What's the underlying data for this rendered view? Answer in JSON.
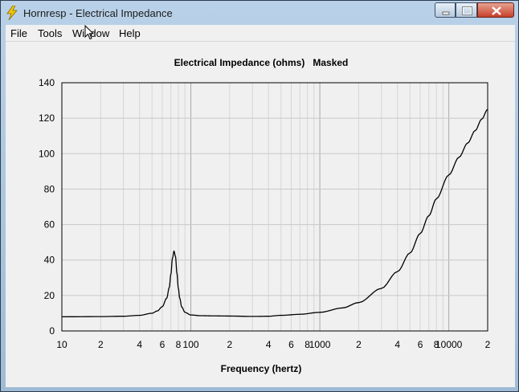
{
  "window": {
    "title": "Hornresp - Electrical Impedance"
  },
  "menu": [
    "File",
    "Tools",
    "Window",
    "Help"
  ],
  "chart_data": {
    "type": "line",
    "title": "Electrical Impedance (ohms)   Masked",
    "xlabel": "Frequency (hertz)",
    "ylabel": "",
    "x_scale": "log",
    "xlim": [
      10,
      20000
    ],
    "ylim": [
      0,
      140
    ],
    "grid": true,
    "yticks": [
      "0",
      "20",
      "40",
      "60",
      "80",
      "100",
      "120",
      "140"
    ],
    "xticks": [
      "10",
      "2",
      "4",
      "6",
      "8",
      "100",
      "2",
      "4",
      "6",
      "8",
      "1000",
      "2",
      "4",
      "6",
      "8",
      "10000",
      "2"
    ],
    "series": [
      {
        "x": [
          10,
          20,
          30,
          40,
          50,
          55,
          60,
          65,
          68,
          70,
          72,
          74,
          76,
          78,
          80,
          82,
          85,
          90,
          100,
          120,
          150,
          200,
          300,
          400,
          500,
          700,
          1000,
          1500,
          2000,
          3000,
          4000,
          5000,
          6000,
          7000,
          8000,
          10000,
          12000,
          14000,
          16000,
          18000,
          20000
        ],
        "y": [
          8.0,
          8.1,
          8.3,
          8.8,
          10.0,
          11.3,
          13.7,
          18.5,
          24.5,
          32.0,
          41.0,
          45.0,
          42.0,
          32.5,
          24.0,
          18.5,
          13.5,
          10.5,
          9.0,
          8.6,
          8.5,
          8.4,
          8.2,
          8.3,
          8.8,
          9.4,
          10.5,
          13.0,
          16.0,
          24.0,
          33.5,
          44.0,
          55.0,
          65.0,
          74.5,
          88.0,
          98.0,
          106.0,
          113.0,
          119.5,
          125.0
        ]
      }
    ]
  }
}
